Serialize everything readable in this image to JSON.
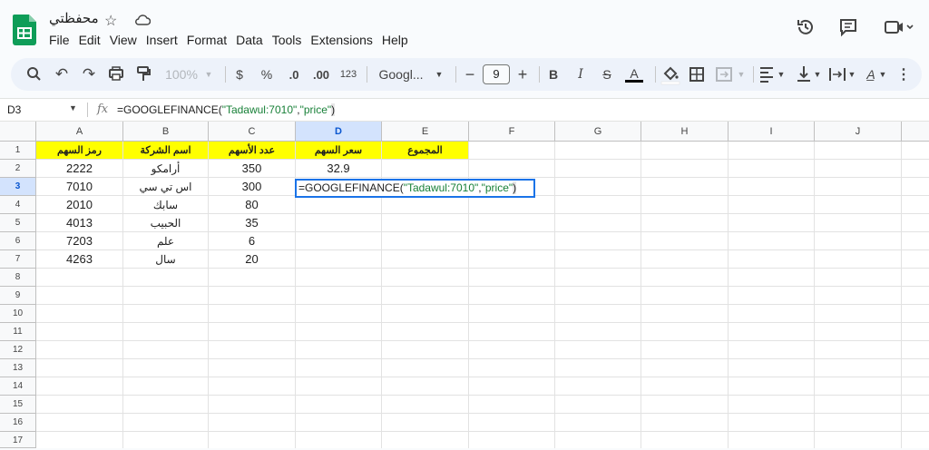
{
  "app": {
    "title": "محفظتي",
    "menu": [
      "File",
      "Edit",
      "View",
      "Insert",
      "Format",
      "Data",
      "Tools",
      "Extensions",
      "Help"
    ]
  },
  "toolbar": {
    "zoom": "100%",
    "currency": "$",
    "percent": "%",
    "dec_decrease": ".0",
    "dec_increase": ".00",
    "number_format": "123",
    "font": "Googl...",
    "font_size": "9",
    "bold": "B",
    "italic": "I",
    "text_color": "A"
  },
  "formula_bar": {
    "name_box": "D3",
    "fx": "fx",
    "formula_prefix": "=GOOGLEFINANCE(",
    "formula_arg1": "\"Tadawul:7010\"",
    "formula_comma": ",",
    "formula_arg2": "\"price\"",
    "formula_close": ")"
  },
  "columns": [
    "A",
    "B",
    "C",
    "D",
    "E",
    "F",
    "G",
    "H",
    "I",
    "J"
  ],
  "rows": [
    "1",
    "2",
    "3",
    "4",
    "5",
    "6",
    "7",
    "8",
    "9",
    "10",
    "11",
    "12",
    "13",
    "14",
    "15",
    "16",
    "17"
  ],
  "sheet": {
    "headers": {
      "a": "رمز السهم",
      "b": "اسم الشركة",
      "c": "عدد الأسهم",
      "d": "سعر السهم",
      "e": "المجموع"
    },
    "data": [
      {
        "a": "2222",
        "b": "أرامكو",
        "c": "350",
        "d": "32.9"
      },
      {
        "a": "7010",
        "b": "اس تي سي",
        "c": "300",
        "d": ""
      },
      {
        "a": "2010",
        "b": "سابك",
        "c": "80",
        "d": ""
      },
      {
        "a": "4013",
        "b": "الحبيب",
        "c": "35",
        "d": ""
      },
      {
        "a": "7203",
        "b": "علم",
        "c": "6",
        "d": ""
      },
      {
        "a": "4263",
        "b": "سال",
        "c": "20",
        "d": ""
      }
    ],
    "active_cell_formula": "=GOOGLEFINANCE(\"Tadawul:7010\",\"price\")"
  },
  "colors": {
    "header_fill": "#ffff00",
    "selection": "#1a73e8",
    "sheets_green": "#0f9d58"
  }
}
